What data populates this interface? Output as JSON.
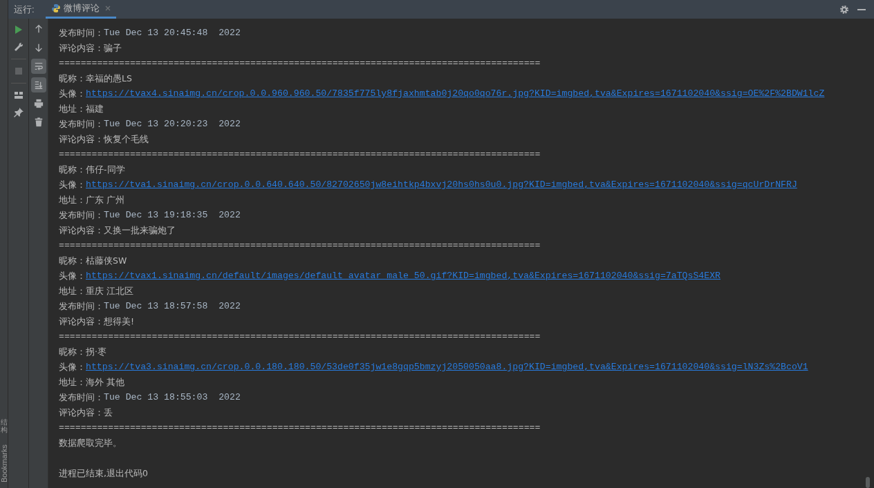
{
  "run_panel": {
    "label": "运行:",
    "tab": {
      "title": "微博评论",
      "selected": true
    }
  },
  "left_strip": [
    {
      "label": "结构",
      "kind": "cjk"
    },
    {
      "label": "Bookmarks",
      "kind": "latin"
    }
  ],
  "toolbar_primary": [
    {
      "kind": "run",
      "disabled": false
    },
    {
      "kind": "wrench",
      "disabled": false
    },
    {
      "kind": "stop",
      "disabled": true
    },
    {
      "kind": "layout",
      "disabled": false
    },
    {
      "kind": "pin",
      "disabled": false
    }
  ],
  "toolbar_secondary": [
    {
      "kind": "up",
      "toggled": false
    },
    {
      "kind": "down",
      "toggled": false
    },
    {
      "kind": "wrap",
      "toggled": true
    },
    {
      "kind": "scroll-end",
      "toggled": true
    },
    {
      "kind": "print",
      "toggled": false
    },
    {
      "kind": "trash",
      "toggled": false
    }
  ],
  "console_lines": [
    {
      "kind": "time",
      "label": "发布时间：",
      "value": "Tue Dec 13 20:45:48  2022"
    },
    {
      "kind": "field",
      "label": "评论内容：",
      "value": "骗子"
    },
    {
      "kind": "separator",
      "text": "========================================================================================"
    },
    {
      "kind": "field",
      "label": "昵称：",
      "value": "幸福的愚LS"
    },
    {
      "kind": "link",
      "label": "头像：",
      "value": "https://tvax4.sinaimg.cn/crop.0.0.960.960.50/7835f775ly8fjaxhmtab0j20qo0qo76r.jpg?KID=imgbed,tva&Expires=1671102040&ssig=OE%2F%2BDW1lcZ"
    },
    {
      "kind": "field",
      "label": "地址：",
      "value": "福建"
    },
    {
      "kind": "time",
      "label": "发布时间：",
      "value": "Tue Dec 13 20:20:23  2022"
    },
    {
      "kind": "field",
      "label": "评论内容：",
      "value": "恢复个毛线"
    },
    {
      "kind": "separator",
      "text": "========================================================================================"
    },
    {
      "kind": "field",
      "label": "昵称：",
      "value": "伟仔-同学"
    },
    {
      "kind": "link",
      "label": "头像：",
      "value": "https://tva1.sinaimg.cn/crop.0.0.640.640.50/82702650jw8eihtkp4bxvj20hs0hs0u0.jpg?KID=imgbed,tva&Expires=1671102040&ssig=qcUrDrNFRJ"
    },
    {
      "kind": "field",
      "label": "地址：",
      "value": "广东 广州"
    },
    {
      "kind": "time",
      "label": "发布时间：",
      "value": "Tue Dec 13 19:18:35  2022"
    },
    {
      "kind": "field",
      "label": "评论内容：",
      "value": "又换一批来骗炮了"
    },
    {
      "kind": "separator",
      "text": "========================================================================================"
    },
    {
      "kind": "field",
      "label": "昵称：",
      "value": "枯藤侠SW"
    },
    {
      "kind": "link",
      "label": "头像：",
      "value": "https://tvax1.sinaimg.cn/default/images/default_avatar_male_50.gif?KID=imgbed,tva&Expires=1671102040&ssig=7aTQsS4EXR"
    },
    {
      "kind": "field",
      "label": "地址：",
      "value": "重庆 江北区"
    },
    {
      "kind": "time",
      "label": "发布时间：",
      "value": "Tue Dec 13 18:57:58  2022"
    },
    {
      "kind": "field",
      "label": "评论内容：",
      "value": "想得美!"
    },
    {
      "kind": "separator",
      "text": "========================================================================================"
    },
    {
      "kind": "field",
      "label": "昵称：",
      "value": "拐·枣"
    },
    {
      "kind": "link",
      "label": "头像：",
      "value": "https://tva3.sinaimg.cn/crop.0.0.180.180.50/53de0f35jw1e8gqp5bmzyj2050050aa8.jpg?KID=imgbed,tva&Expires=1671102040&ssig=lN3Zs%2BcoV1"
    },
    {
      "kind": "field",
      "label": "地址：",
      "value": "海外 其他"
    },
    {
      "kind": "time",
      "label": "发布时间：",
      "value": "Tue Dec 13 18:55:03  2022"
    },
    {
      "kind": "field",
      "label": "评论内容：",
      "value": "丢"
    },
    {
      "kind": "separator",
      "text": "========================================================================================"
    },
    {
      "kind": "text",
      "text": "数据爬取完毕。"
    },
    {
      "kind": "blank"
    },
    {
      "kind": "text",
      "text": "进程已结束,退出代码0"
    }
  ]
}
